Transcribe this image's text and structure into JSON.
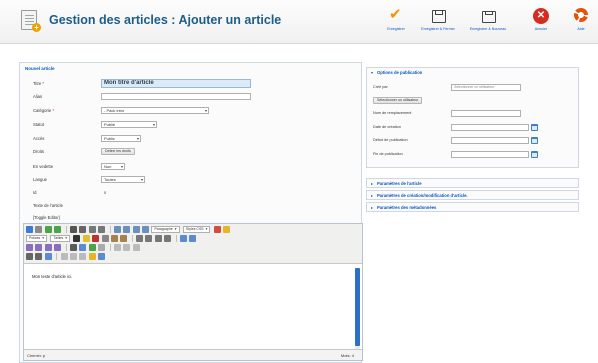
{
  "header": {
    "title": "Gestion des articles : Ajouter un article"
  },
  "toolbar": {
    "apply": "Enregistrer",
    "save_close": "Enregistrer & Fermer",
    "save_new": "Enregistrer & Nouveau",
    "cancel": "Annuler",
    "help": "Aide"
  },
  "form": {
    "legend": "Nouvel article",
    "title_label": "Titre",
    "title_value": "Mon titre d'article",
    "alias_label": "Alias",
    "alias_value": "",
    "category_label": "Catégorie",
    "category_value": "- Pack intro",
    "status_label": "Statut",
    "status_value": "Publié",
    "access_label": "Accès",
    "access_value": "Public",
    "rights_label": "Droits",
    "rights_button": "Définir les droits",
    "featured_label": "En vedette",
    "featured_value": "Non",
    "language_label": "Langue",
    "language_value": "Toutes",
    "id_label": "Id",
    "id_value": "0",
    "article_text_label": "Texte de l'article",
    "toggle_editor": "[Toggle Editor]"
  },
  "editor": {
    "font_family": "Polices",
    "font_size": "Tailles",
    "paragraph": "Paragraphe",
    "styles": "Styles CSS",
    "content": "Mon texte d'article ici.",
    "path": "Chemin: p",
    "words": "Mots: 4"
  },
  "side": {
    "publishing_title": "Options de publication",
    "created_by_label": "Créé par",
    "created_by_value": "Sélectionner un utilisateur",
    "select_user_button": "Sélectionner un utilisateur",
    "created_alias_label": "Nom de remplacement",
    "created_date_label": "Date de création",
    "publish_up_label": "Début de publication",
    "publish_down_label": "Fin de publication",
    "article_params": "Paramètres de l'article",
    "creation_params": "Paramètres de création/modification d'article.",
    "metadata_params": "Paramètres des métadonnées"
  },
  "colors": {
    "link": "#0b55c4",
    "title": "#1d5d8a",
    "accent": "#f29400",
    "cancel": "#d62b1e"
  }
}
